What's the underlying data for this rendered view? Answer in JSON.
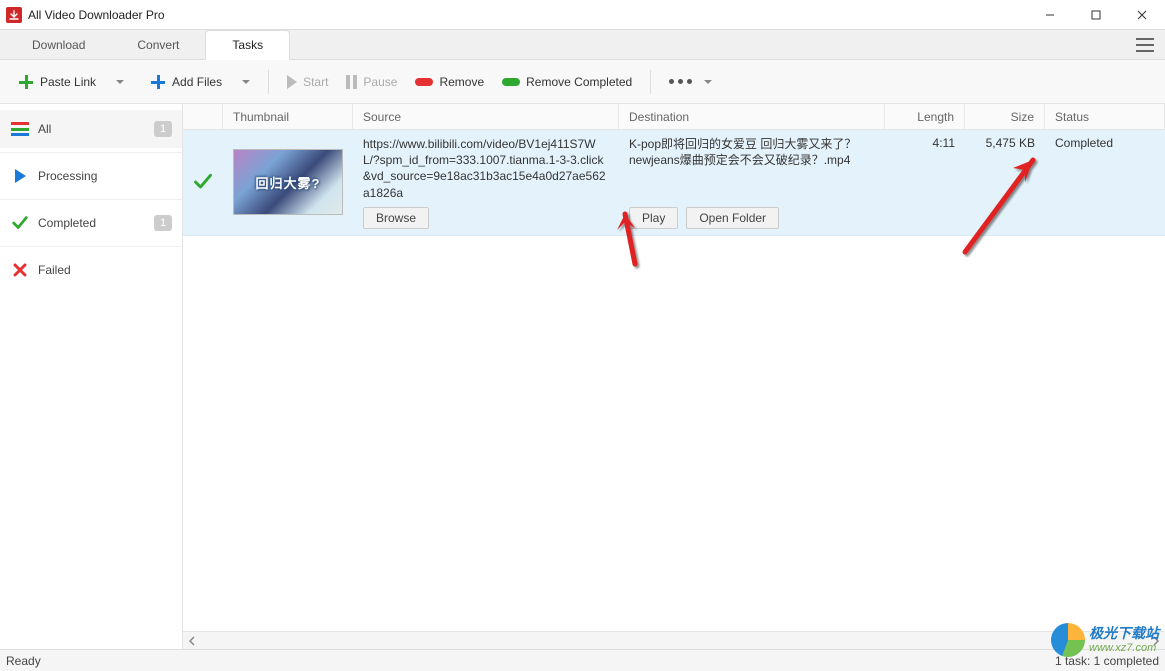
{
  "app": {
    "title": "All Video Downloader Pro"
  },
  "tabs": {
    "download": "Download",
    "convert": "Convert",
    "tasks": "Tasks"
  },
  "toolbar": {
    "paste_link": "Paste Link",
    "add_files": "Add Files",
    "start": "Start",
    "pause": "Pause",
    "remove": "Remove",
    "remove_completed": "Remove Completed"
  },
  "sidebar": {
    "all": "All",
    "all_count": "1",
    "processing": "Processing",
    "completed": "Completed",
    "completed_count": "1",
    "failed": "Failed"
  },
  "columns": {
    "thumbnail": "Thumbnail",
    "source": "Source",
    "destination": "Destination",
    "length": "Length",
    "size": "Size",
    "status": "Status"
  },
  "task": {
    "thumb_caption": "回归大雾?",
    "source_url": "https://www.bilibili.com/video/BV1ej411S7WL/?spm_id_from=333.1007.tianma.1-3-3.click&vd_source=9e18ac31b3ac15e4a0d27ae562a1826a",
    "dest_filename": "K-pop即将回归的女爱豆 回归大雾又来了？ newjeans爆曲预定会不会又破纪录？.mp4",
    "length": "4:11",
    "size": "5,475 KB",
    "status": "Completed",
    "browse_btn": "Browse",
    "play_btn": "Play",
    "open_folder_btn": "Open Folder"
  },
  "statusbar": {
    "left": "Ready",
    "right": "1 task: 1 completed"
  },
  "watermark": {
    "line1": "极光下载站",
    "line2": "www.xz7.com"
  }
}
